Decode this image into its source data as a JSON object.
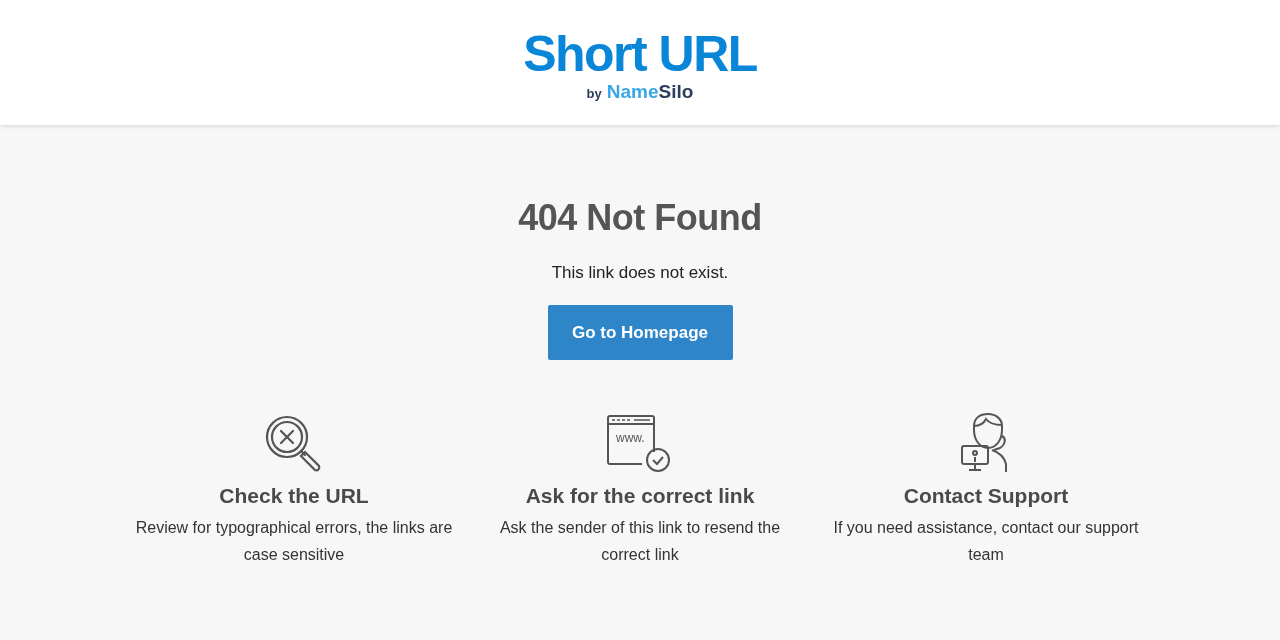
{
  "header": {
    "logo_title": "Short URL",
    "logo_by": "by",
    "logo_brand_first": "Name",
    "logo_brand_second": "Silo"
  },
  "main": {
    "title": "404 Not Found",
    "message": "This link does not exist.",
    "button": "Go to Homepage"
  },
  "tips": [
    {
      "kind": "search",
      "title": "Check the URL",
      "text": "Review for typographical errors, the links are case sensitive"
    },
    {
      "kind": "browser",
      "icon_text": "www.",
      "title": "Ask for the correct link",
      "text": "Ask the sender of this link to resend the correct link"
    },
    {
      "kind": "support",
      "title": "Contact Support",
      "text": "If you need assistance, contact our support team"
    }
  ]
}
